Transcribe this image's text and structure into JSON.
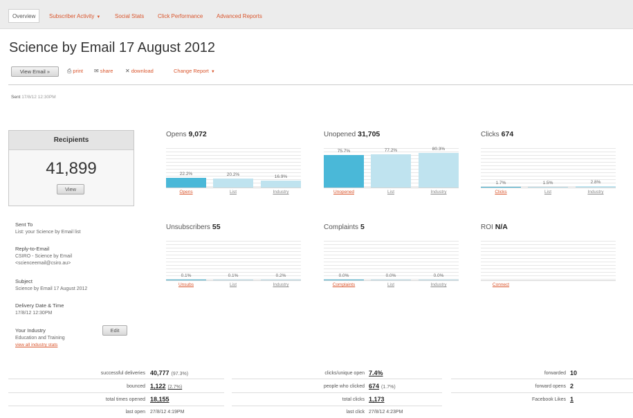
{
  "nav": {
    "tabs": [
      {
        "label": "Overview"
      },
      {
        "label": "Subscriber Activity"
      },
      {
        "label": "Social Stats"
      },
      {
        "label": "Click Performance"
      },
      {
        "label": "Advanced Reports"
      }
    ],
    "caret": "▼"
  },
  "title": "Science by Email 17 August 2012",
  "toolbar": {
    "view_email": "View Email »",
    "print": "print",
    "share": "share",
    "download": "download",
    "change_report": "Change Report"
  },
  "sent": {
    "label": "Sent",
    "value": "17/8/12 12:30PM"
  },
  "recipients": {
    "title": "Recipients",
    "count": "41,899",
    "view": "View"
  },
  "details": {
    "sent_to_label": "Sent To",
    "sent_to_value": "List: your Science by Email list",
    "reply_label": "Reply-to-Email",
    "reply_name": "CSIRO - Science by Email",
    "reply_email": "<scienceemail@csiro.au>",
    "subject_label": "Subject",
    "subject_value": "Science by Email 17 August 2012",
    "delivery_label": "Delivery Date & Time",
    "delivery_value": "17/8/12 12:30PM",
    "industry_label": "Your Industry",
    "industry_value": "Education and Training",
    "industry_link": "view all industry stats",
    "edit": "Edit"
  },
  "chart_data": [
    {
      "type": "bar",
      "title": "Opens",
      "total": "9,072",
      "categories": [
        "Opens",
        "List",
        "Industry"
      ],
      "values": [
        22.2,
        20.2,
        16.9
      ],
      "labels": [
        "22.2%",
        "20.2%",
        "16.9%"
      ],
      "ylim": [
        0,
        100
      ]
    },
    {
      "type": "bar",
      "title": "Unopened",
      "total": "31,705",
      "categories": [
        "Unopened",
        "List",
        "Industry"
      ],
      "values": [
        75.7,
        77.2,
        80.3
      ],
      "labels": [
        "75.7%",
        "77.2%",
        "80.3%"
      ],
      "ylim": [
        0,
        100
      ]
    },
    {
      "type": "bar",
      "title": "Clicks",
      "total": "674",
      "categories": [
        "Clicks",
        "List",
        "Industry"
      ],
      "values": [
        1.7,
        1.5,
        2.8
      ],
      "labels": [
        "1.7%",
        "1.5%",
        "2.8%"
      ],
      "ylim": [
        0,
        100
      ]
    },
    {
      "type": "bar",
      "title": "Unsubscribers",
      "total": "55",
      "categories": [
        "Unsubs",
        "List",
        "Industry"
      ],
      "values": [
        0.1,
        0.1,
        0.2
      ],
      "labels": [
        "0.1%",
        "0.1%",
        "0.2%"
      ],
      "ylim": [
        0,
        100
      ]
    },
    {
      "type": "bar",
      "title": "Complaints",
      "total": "5",
      "categories": [
        "Complaints",
        "List",
        "Industry"
      ],
      "values": [
        0.0,
        0.0,
        0.0
      ],
      "labels": [
        "0.0%",
        "0.0%",
        "0.0%"
      ],
      "ylim": [
        0,
        100
      ]
    },
    {
      "type": "bar",
      "title": "ROI",
      "total": "N/A",
      "categories": [
        "Connect"
      ],
      "values": [],
      "labels": [],
      "ylim": [
        0,
        100
      ]
    }
  ],
  "colors": {
    "primary_bar": "#4ab8d8",
    "secondary_bar": "#bfe3ef",
    "link": "#d9542b"
  },
  "stats": {
    "col1": [
      {
        "label": "successful deliveries",
        "value": "40,777",
        "extra": "(97.3%)"
      },
      {
        "label": "bounced",
        "value": "1,122",
        "extra": "(2.7%)"
      },
      {
        "label": "total times opened",
        "value": "18,155",
        "extra": ""
      },
      {
        "label": "last open",
        "value": "27/8/12 4:19PM",
        "extra": ""
      }
    ],
    "col2": [
      {
        "label": "clicks/unique open",
        "value": "7.4%",
        "extra": ""
      },
      {
        "label": "people who clicked",
        "value": "674",
        "extra": "(1.7%)"
      },
      {
        "label": "total clicks",
        "value": "1,173",
        "extra": ""
      },
      {
        "label": "last click",
        "value": "27/8/12 4:23PM",
        "extra": ""
      }
    ],
    "col3": [
      {
        "label": "forwarded",
        "value": "10"
      },
      {
        "label": "forward opens",
        "value": "2"
      },
      {
        "label": "Facebook Likes",
        "value": "1"
      }
    ]
  }
}
